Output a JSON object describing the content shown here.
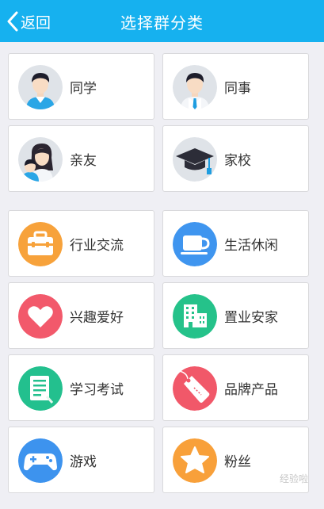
{
  "header": {
    "back_label": "返回",
    "title": "选择群分类",
    "color": "#16b1ef"
  },
  "groups": [
    [
      {
        "label": "同学",
        "icon": "classmate-avatar-icon"
      },
      {
        "label": "同事",
        "icon": "colleague-avatar-icon"
      },
      {
        "label": "亲友",
        "icon": "family-avatar-icon"
      },
      {
        "label": "家校",
        "icon": "graduation-cap-icon"
      }
    ],
    [
      {
        "label": "行业交流",
        "icon": "briefcase-icon",
        "color": "#f7a23b"
      },
      {
        "label": "生活休闲",
        "icon": "coffee-cup-icon",
        "color": "#3f95ef"
      },
      {
        "label": "兴趣爱好",
        "icon": "heart-icon",
        "color": "#f2596b"
      },
      {
        "label": "置业安家",
        "icon": "buildings-icon",
        "color": "#25c28a"
      },
      {
        "label": "学习考试",
        "icon": "notebook-icon",
        "color": "#23c08e"
      },
      {
        "label": "品牌产品",
        "icon": "price-tag-icon",
        "color": "#f15869"
      },
      {
        "label": "游戏",
        "icon": "gamepad-icon",
        "color": "#3d93ee"
      },
      {
        "label": "粉丝",
        "icon": "star-icon",
        "color": "#f8a03a"
      }
    ]
  ],
  "watermark": "经验啦"
}
